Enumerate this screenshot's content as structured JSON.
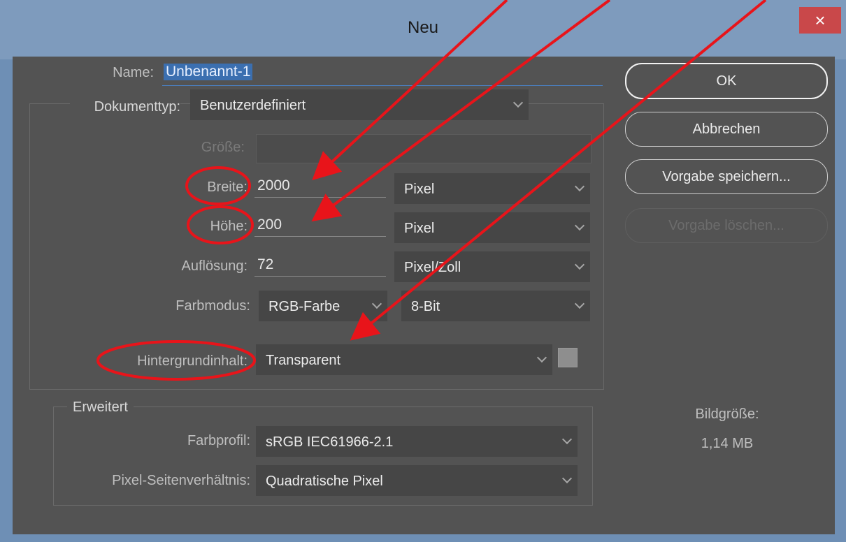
{
  "window": {
    "title": "Neu",
    "close_glyph": "×"
  },
  "fields": {
    "name_label": "Name:",
    "name_value": "Unbenannt-1",
    "dokumenttyp_label": "Dokumenttyp:",
    "dokumenttyp_value": "Benutzerdefiniert",
    "groesse_label": "Größe:",
    "breite_label": "Breite:",
    "breite_value": "2000",
    "breite_unit": "Pixel",
    "hoehe_label": "Höhe:",
    "hoehe_value": "200",
    "hoehe_unit": "Pixel",
    "aufloesung_label": "Auflösung:",
    "aufloesung_value": "72",
    "aufloesung_unit": "Pixel/Zoll",
    "farbmodus_label": "Farbmodus:",
    "farbmodus_value": "RGB-Farbe",
    "farbmodus_bit": "8-Bit",
    "hintergrund_label": "Hintergrundinhalt:",
    "hintergrund_value": "Transparent"
  },
  "advanced": {
    "title": "Erweitert",
    "farbprofil_label": "Farbprofil:",
    "farbprofil_value": "sRGB IEC61966-2.1",
    "pixel_label": "Pixel-Seitenverhältnis:",
    "pixel_value": "Quadratische Pixel"
  },
  "buttons": {
    "ok": "OK",
    "cancel": "Abbrechen",
    "save_preset": "Vorgabe speichern...",
    "delete_preset": "Vorgabe löschen..."
  },
  "info": {
    "bildgroesse_label": "Bildgröße:",
    "bildgroesse_value": "1,14 MB"
  },
  "colors": {
    "annotation": "#e8141a",
    "dialog_bg": "#535353",
    "titlebar": "#7e9bbd",
    "close": "#c9484a",
    "selection": "#4a7fbf"
  }
}
